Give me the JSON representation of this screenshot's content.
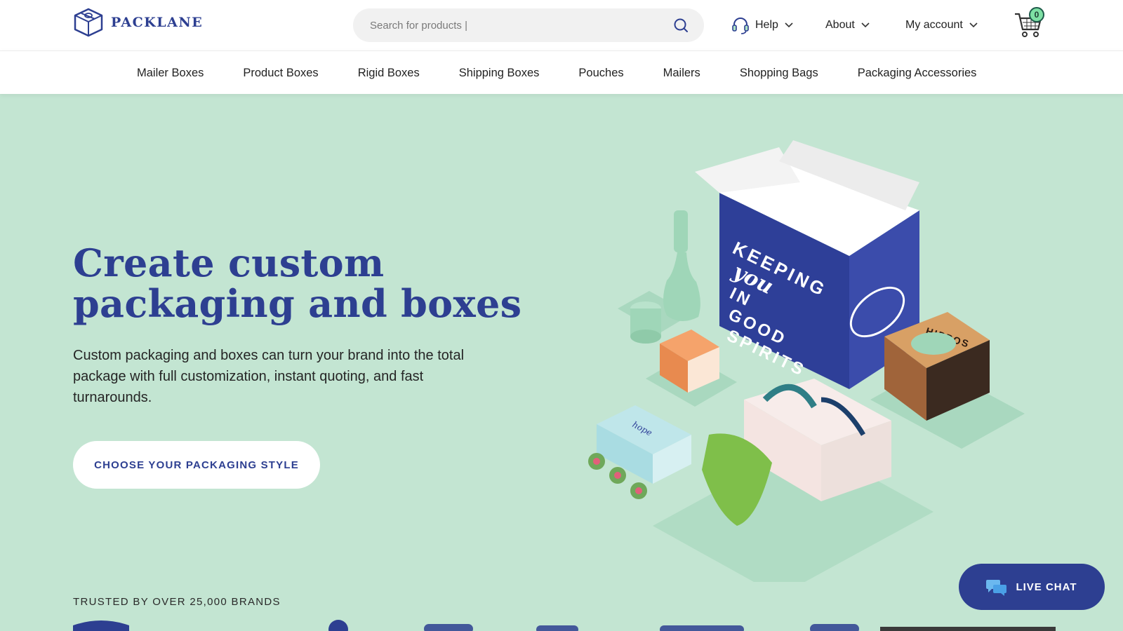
{
  "brand": {
    "name": "PACKLANE"
  },
  "search": {
    "placeholder": "Search for products |"
  },
  "header_nav": {
    "help": "Help",
    "about": "About",
    "account": "My account",
    "cart_count": "0"
  },
  "categories": [
    "Mailer Boxes",
    "Product Boxes",
    "Rigid Boxes",
    "Shipping Boxes",
    "Pouches",
    "Mailers",
    "Shopping Bags",
    "Packaging Accessories"
  ],
  "hero": {
    "title_line1": "Create custom",
    "title_line2": "packaging and boxes",
    "subtitle": "Custom packaging and boxes can turn your brand into the total package with full customization, instant quoting, and fast turnarounds.",
    "cta": "CHOOSE YOUR PACKAGING STYLE"
  },
  "hero_box_text": {
    "line1": "KEEPING",
    "line2": "you",
    "line3": "IN",
    "line4": "GOOD",
    "line5": "SPIRITS",
    "hippos": "HIPPOS",
    "hope": "hope"
  },
  "trusted": {
    "label": "TRUSTED BY OVER 25,000 BRANDS"
  },
  "chat": {
    "label": "LIVE CHAT"
  },
  "colors": {
    "brand_blue": "#2d3f91",
    "hero_bg": "#c3e5d2",
    "cart_badge": "#7ee0a4"
  }
}
